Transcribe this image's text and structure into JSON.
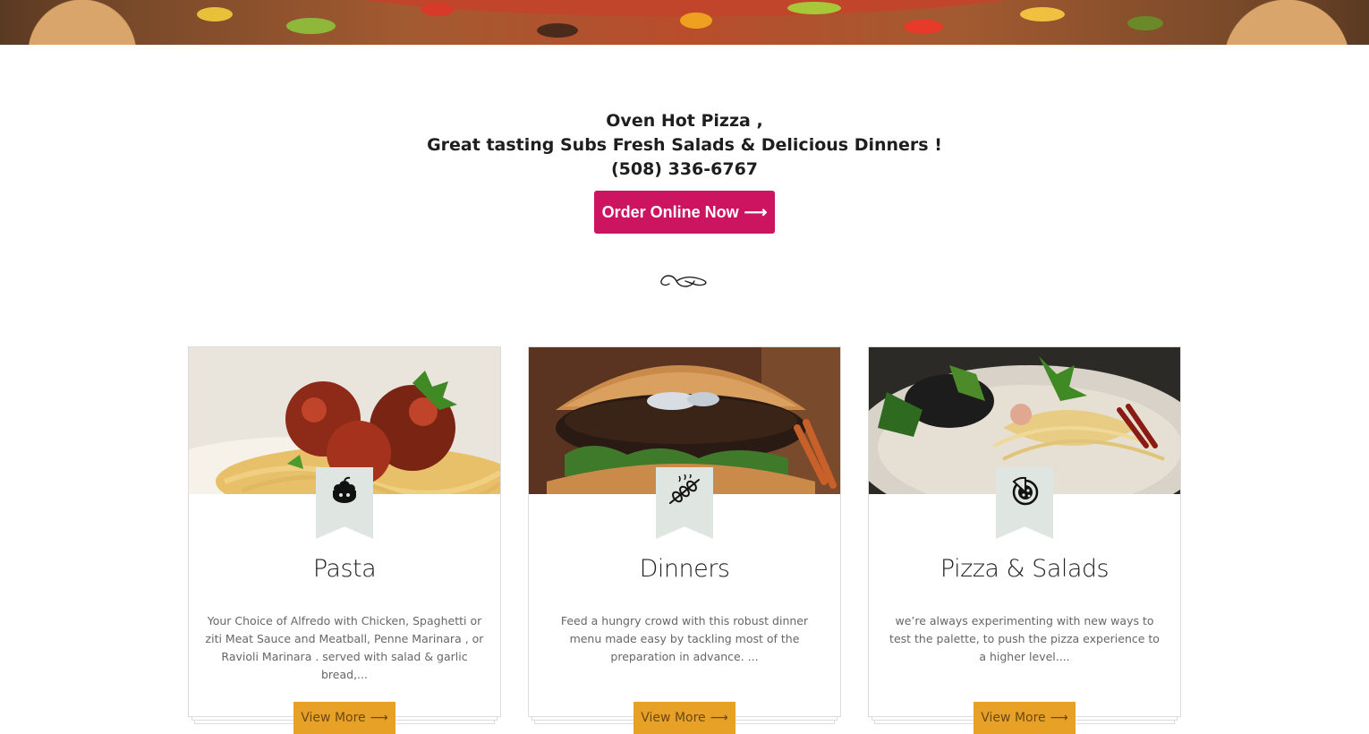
{
  "intro": {
    "line1": "Oven Hot Pizza ,",
    "line2": "Great tasting Subs Fresh Salads & Delicious Dinners !",
    "phone": "(508) 336-6767",
    "order_label": "Order Online Now",
    "order_arrow": "⟶"
  },
  "colors": {
    "order_button": "#cc1460",
    "view_more_button": "#e8a127",
    "ribbon": "#dfe6e2"
  },
  "cards": [
    {
      "title": "Pasta",
      "icon": "chef-hat-pot-icon",
      "description": "Your Choice of Alfredo with Chicken, Spaghetti or ziti Meat Sauce and Meatball, Penne Marinara , or Ravioli Marinara . served with salad & garlic bread,...",
      "button_label": "View More",
      "button_arrow": "⟶"
    },
    {
      "title": "Dinners",
      "icon": "kebab-skewer-icon",
      "description": "Feed a hungry crowd with this robust dinner menu made easy by tackling most of the preparation in advance. ...",
      "button_label": "View More",
      "button_arrow": "⟶"
    },
    {
      "title": "Pizza & Salads",
      "icon": "pizza-slice-icon",
      "description": "we’re always experimenting with new ways to test the palette, to push the pizza experience to a higher level....",
      "button_label": "View More",
      "button_arrow": "⟶"
    }
  ]
}
